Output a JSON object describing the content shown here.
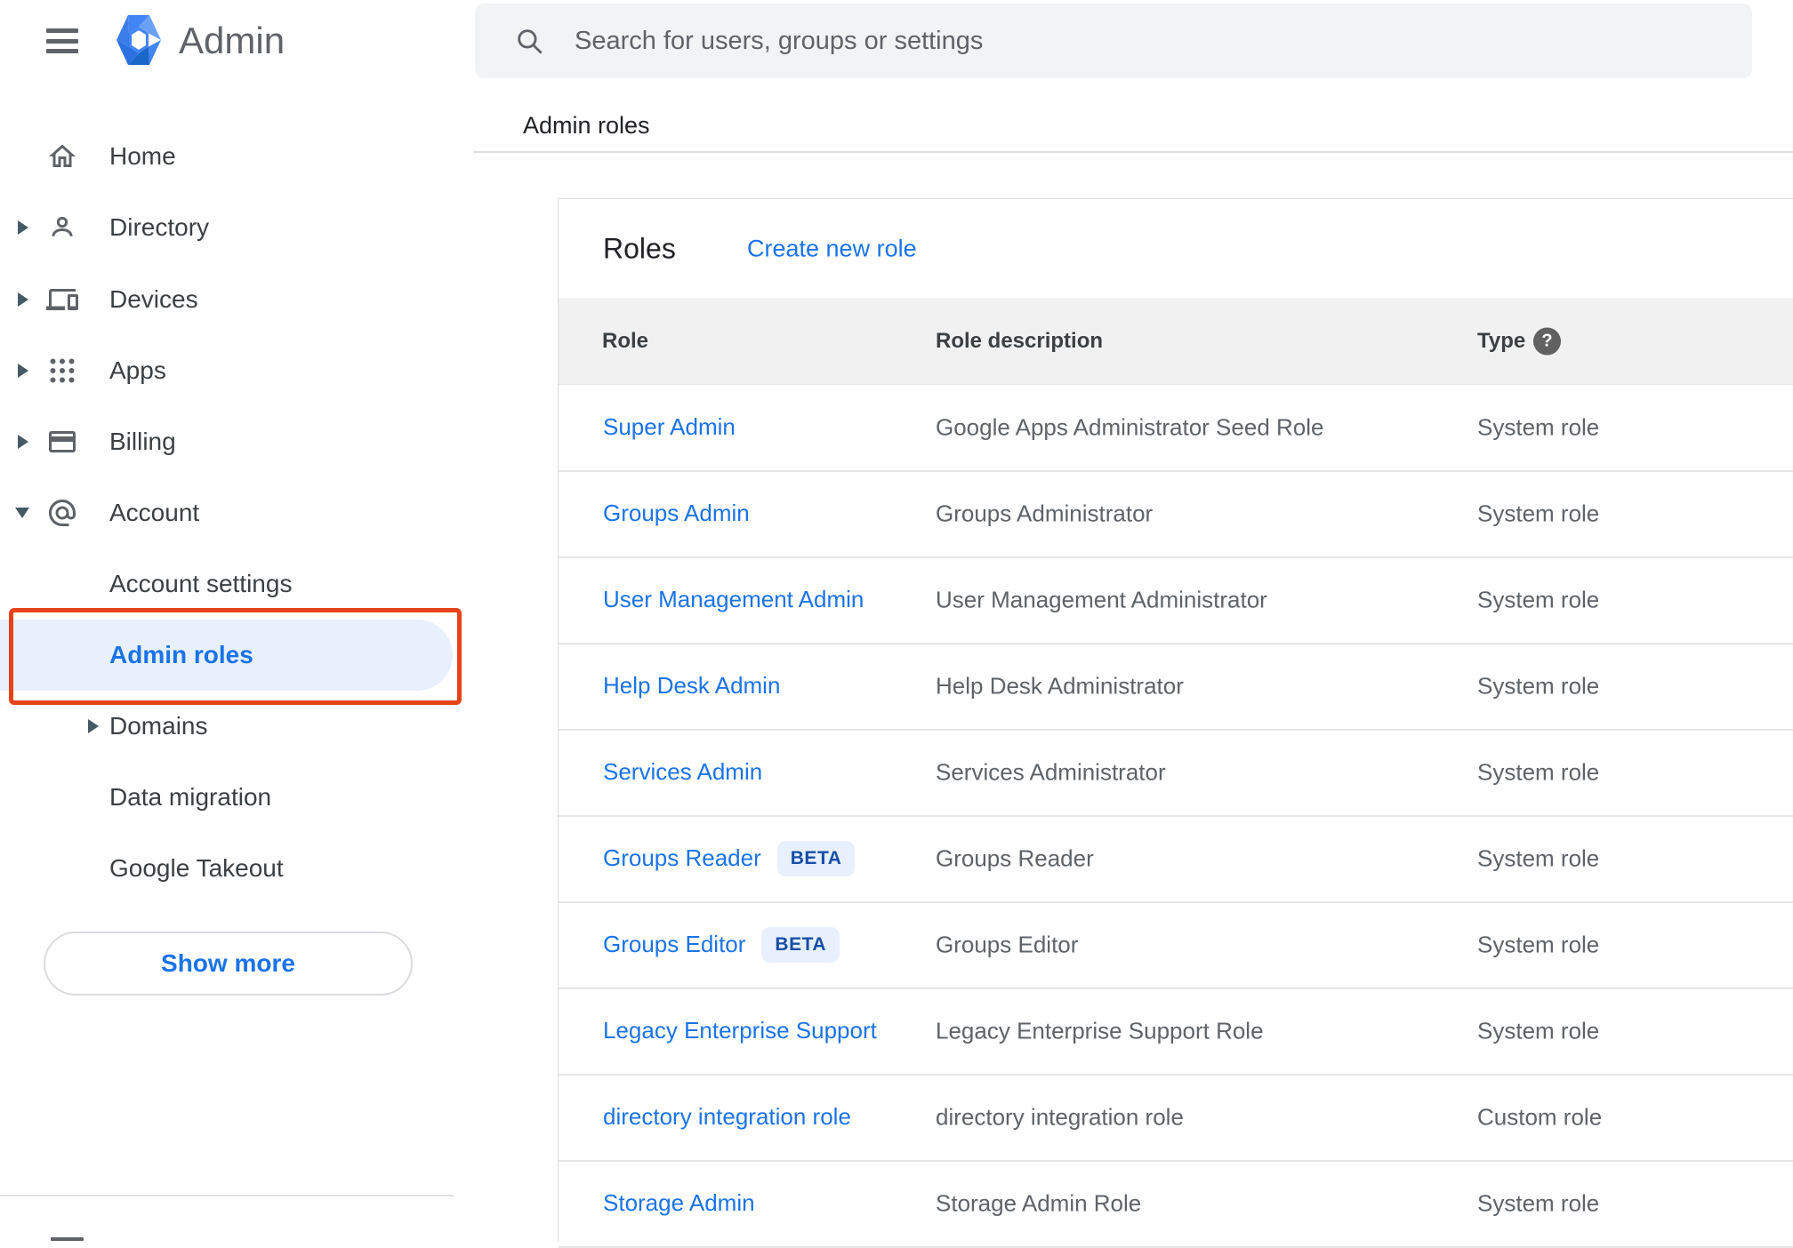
{
  "app": {
    "logo_text": "Admin"
  },
  "topbar": {
    "search_placeholder": "Search for users, groups or settings"
  },
  "breadcrumb": "Admin roles",
  "sidebar": {
    "items": [
      {
        "label": "Home"
      },
      {
        "label": "Directory"
      },
      {
        "label": "Devices"
      },
      {
        "label": "Apps"
      },
      {
        "label": "Billing"
      },
      {
        "label": "Account"
      }
    ],
    "account_subitems": [
      {
        "label": "Account settings"
      },
      {
        "label": "Admin roles",
        "selected": true
      },
      {
        "label": "Domains"
      },
      {
        "label": "Data migration"
      },
      {
        "label": "Google Takeout"
      }
    ],
    "show_more": "Show more"
  },
  "roles_panel": {
    "title": "Roles",
    "create_link": "Create new role",
    "columns": {
      "role": "Role",
      "description": "Role description",
      "type": "Type"
    },
    "help_glyph": "?",
    "rows": [
      {
        "role": "Super Admin",
        "description": "Google Apps Administrator Seed Role",
        "type": "System role"
      },
      {
        "role": "Groups Admin",
        "description": "Groups Administrator",
        "type": "System role"
      },
      {
        "role": "User Management Admin",
        "description": "User Management Administrator",
        "type": "System role"
      },
      {
        "role": "Help Desk Admin",
        "description": "Help Desk Administrator",
        "type": "System role"
      },
      {
        "role": "Services Admin",
        "description": "Services Administrator",
        "type": "System role"
      },
      {
        "role": "Groups Reader",
        "badge": "BETA",
        "description": "Groups Reader",
        "type": "System role"
      },
      {
        "role": "Groups Editor",
        "badge": "BETA",
        "description": "Groups Editor",
        "type": "System role"
      },
      {
        "role": "Legacy Enterprise Support",
        "description": "Legacy Enterprise Support Role",
        "type": "System role"
      },
      {
        "role": "directory integration role",
        "description": "directory integration role",
        "type": "Custom role"
      },
      {
        "role": "Storage Admin",
        "description": "Storage Admin Role",
        "type": "System role"
      }
    ]
  },
  "colors": {
    "link_blue": "#1a73e8",
    "selected_bg": "#e8f0fe",
    "badge_bg": "#e8f0fe",
    "badge_text": "#174ea6",
    "annotation_red": "#e8421a",
    "header_band": "#f1f1f1",
    "icon_gray": "#5f6368"
  }
}
